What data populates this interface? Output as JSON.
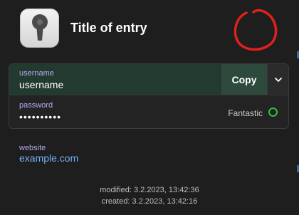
{
  "entry": {
    "title": "Title of entry",
    "icon": "keyhole-icon"
  },
  "fields": {
    "username": {
      "label": "username",
      "value": "username",
      "copy_label": "Copy",
      "menu_icon": "chevron-down-icon"
    },
    "password": {
      "label": "password",
      "value": "••••••••••",
      "strength": "Fantastic",
      "strength_color": "#2fbf3a"
    }
  },
  "website": {
    "label": "website",
    "value": "example.com"
  },
  "meta": {
    "modified_label": "modified:",
    "modified_value": "3.2.2023, 13:42:36",
    "created_label": "created:",
    "created_value": "3.2.2023, 13:42:16"
  },
  "colors": {
    "background": "#1e1e1e",
    "accent_label": "#b7a8ef",
    "link": "#6fb1f2",
    "annotation_red": "#e0201c"
  }
}
